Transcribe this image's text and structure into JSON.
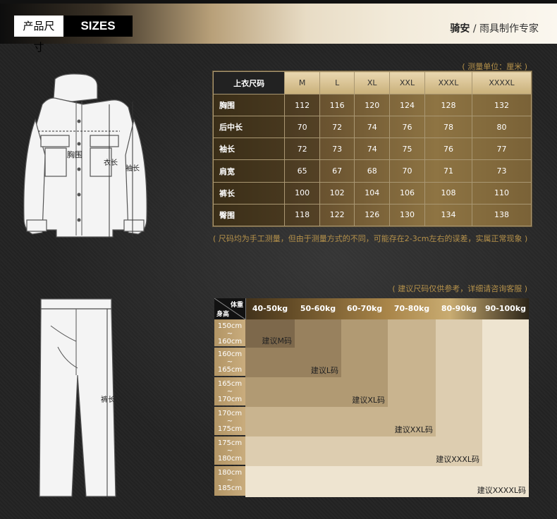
{
  "header": {
    "label_cn": "产品尺寸",
    "label_en": "SIZES",
    "brand": "骑安",
    "slogan": "/ 雨具制作专家"
  },
  "illustration": {
    "jacket": {
      "chest": "胸围",
      "length": "衣长",
      "sleeve": "袖长"
    },
    "pants": {
      "length": "裤长"
    }
  },
  "size_table": {
    "unit_note": "( 测量单位：厘米 )",
    "corner": "上衣尺码",
    "sizes": [
      "M",
      "L",
      "XL",
      "XXL",
      "XXXL",
      "XXXXL"
    ],
    "rows": [
      {
        "label": "胸围",
        "values": [
          "112",
          "116",
          "120",
          "124",
          "128",
          "132"
        ]
      },
      {
        "label": "后中长",
        "values": [
          "70",
          "72",
          "74",
          "76",
          "78",
          "80"
        ]
      },
      {
        "label": "袖长",
        "values": [
          "72",
          "73",
          "74",
          "75",
          "76",
          "77"
        ]
      },
      {
        "label": "肩宽",
        "values": [
          "65",
          "67",
          "68",
          "70",
          "71",
          "73"
        ]
      },
      {
        "label": "裤长",
        "values": [
          "100",
          "102",
          "104",
          "106",
          "108",
          "110"
        ]
      },
      {
        "label": "臀围",
        "values": [
          "118",
          "122",
          "126",
          "130",
          "134",
          "138"
        ]
      }
    ],
    "footnote": "( 尺码均为手工测量，但由于测量方式的不同，可能存在2-3cm左右的误差，实属正常现象 )"
  },
  "recommend": {
    "note": "( 建议尺码仅供参考，详细请咨询客服 )",
    "corner_weight": "体重",
    "corner_height": "身高",
    "weights": [
      "40-50kg",
      "50-60kg",
      "60-70kg",
      "70-80kg",
      "80-90kg",
      "90-100kg"
    ],
    "heights": [
      {
        "top": "150cm",
        "sep": "~",
        "bottom": "160cm"
      },
      {
        "top": "160cm",
        "sep": "~",
        "bottom": "165cm"
      },
      {
        "top": "165cm",
        "sep": "~",
        "bottom": "170cm"
      },
      {
        "top": "170cm",
        "sep": "~",
        "bottom": "175cm"
      },
      {
        "top": "175cm",
        "sep": "~",
        "bottom": "180cm"
      },
      {
        "top": "180cm",
        "sep": "~",
        "bottom": "185cm"
      }
    ],
    "suggestions": [
      "建议M码",
      "建议L码",
      "建议XL码",
      "建议XXL码",
      "建议XXXL码",
      "建议XXXXL码"
    ],
    "colors": [
      "#7d684b",
      "#98815e",
      "#b19a73",
      "#c9b48f",
      "#ddcdb0",
      "#eee4d0"
    ]
  }
}
